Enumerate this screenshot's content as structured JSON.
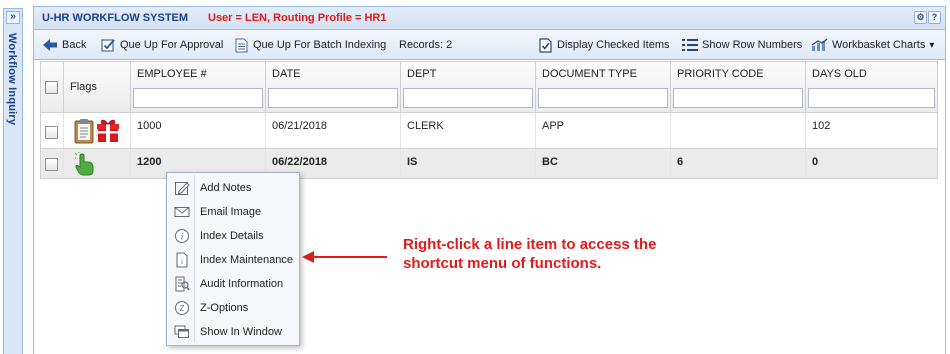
{
  "rail": {
    "expand": "»",
    "title": "Workflow Inquiry"
  },
  "header": {
    "title": "U-HR WORKFLOW SYSTEM",
    "user_info": "User = LEN, Routing Profile = HR1",
    "tool_gear": "⚙",
    "tool_help": "?"
  },
  "toolbar": {
    "back": "Back",
    "que_up_approval": "Que Up For Approval",
    "que_up_batch": "Que Up For Batch Indexing",
    "records": "Records: 2",
    "display_checked": "Display Checked Items",
    "show_row_numbers": "Show Row Numbers",
    "workbasket_charts": "Workbasket Charts",
    "dropdown_arrow": "▾"
  },
  "grid": {
    "flags_header": "Flags",
    "columns": [
      "EMPLOYEE #",
      "DATE",
      "DEPT",
      "DOCUMENT TYPE",
      "PRIORITY CODE",
      "DAYS OLD"
    ],
    "rows": [
      {
        "flags": [
          "clipboard-icon",
          "gift-icon"
        ],
        "cells": [
          "1000",
          "06/21/2018",
          "CLERK",
          "APP",
          "",
          "102"
        ]
      },
      {
        "flags": [
          "hand-pointer-icon"
        ],
        "cells": [
          "1200",
          "06/22/2018",
          "IS",
          "BC",
          "6",
          "0"
        ]
      }
    ]
  },
  "context_menu": {
    "items": [
      {
        "label": "Add Notes",
        "icon": "pencil-icon"
      },
      {
        "label": "Email Image",
        "icon": "envelope-icon"
      },
      {
        "label": "Index Details",
        "icon": "info-icon"
      },
      {
        "label": "Index Maintenance",
        "icon": "document-info-icon"
      },
      {
        "label": "Audit Information",
        "icon": "audit-icon"
      },
      {
        "label": "Z-Options",
        "icon": "z-circle-icon"
      },
      {
        "label": "Show In Window",
        "icon": "windows-icon"
      }
    ]
  },
  "annotation": {
    "text": "Right-click a line item to access the\nshortcut menu of functions.",
    "color": "#e01b1b"
  },
  "colors": {
    "accent": "#15428b",
    "header_red": "#e01b1b",
    "border": "#99bbe8"
  }
}
